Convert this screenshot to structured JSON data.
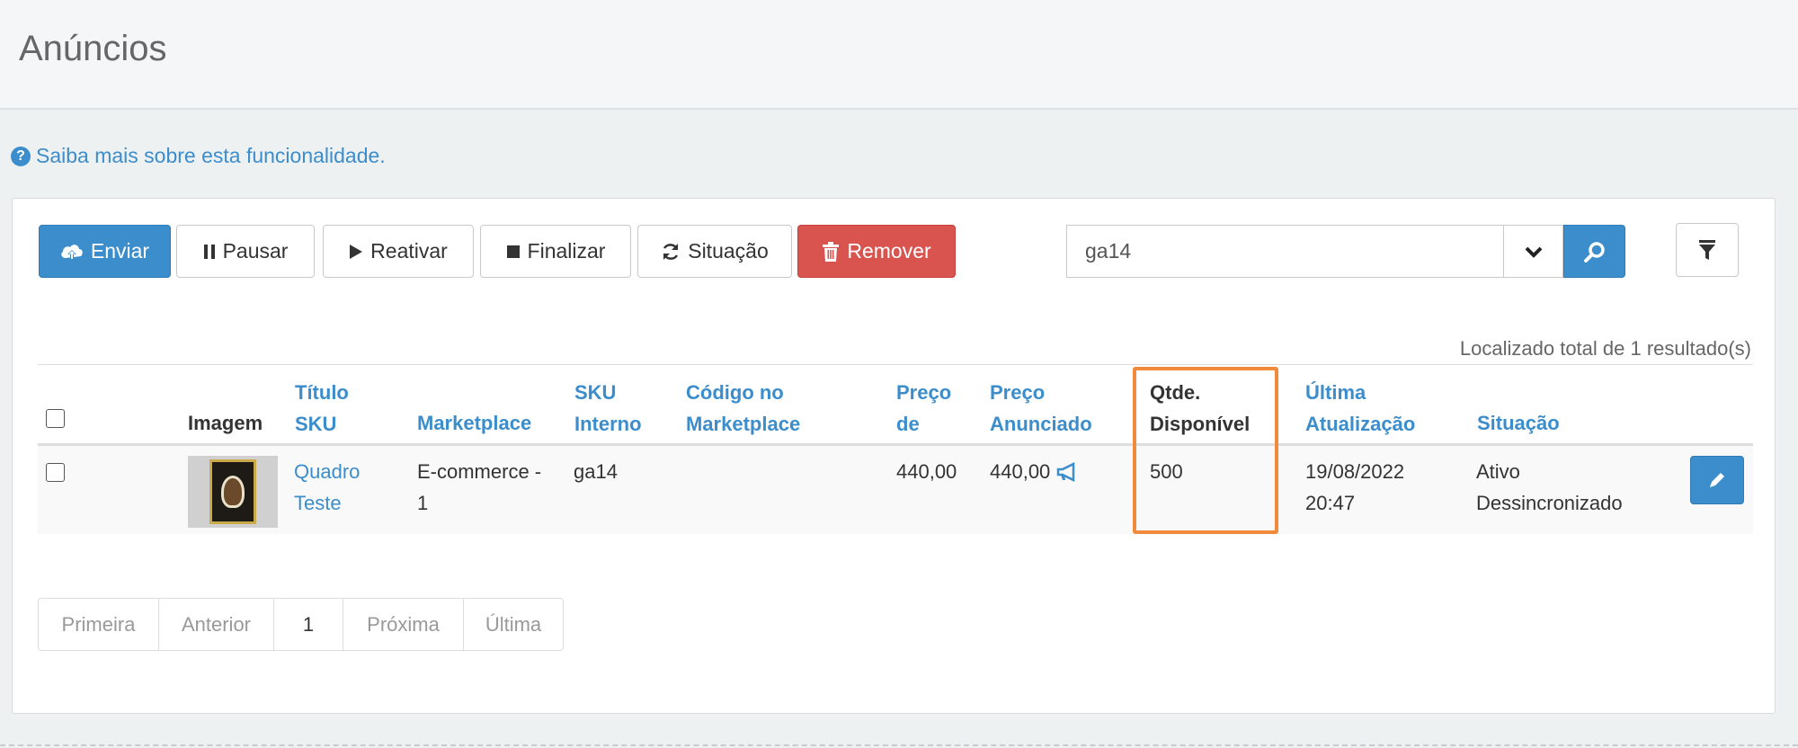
{
  "page": {
    "title": "Anúncios",
    "help_link": "Saiba mais sobre esta funcionalidade."
  },
  "toolbar": {
    "send": "Enviar",
    "pause": "Pausar",
    "reactivate": "Reativar",
    "finish": "Finalizar",
    "status": "Situação",
    "remove": "Remover"
  },
  "search": {
    "value": "ga14"
  },
  "results": {
    "total": "Localizado total de 1 resultado(s)"
  },
  "table": {
    "headers": {
      "image": "Imagem",
      "title_line1": "Título",
      "title_line2": "SKU",
      "marketplace": "Marketplace",
      "sku_line1": "SKU",
      "sku_line2": "Interno",
      "code_line1": "Código no",
      "code_line2": "Marketplace",
      "price_line1": "Preço",
      "price_line2": "de",
      "listed_line1": "Preço",
      "listed_line2": "Anunciado",
      "qty_line1": "Qtde.",
      "qty_line2": "Disponível",
      "updated_line1": "Última",
      "updated_line2": "Atualização",
      "status": "Situação"
    },
    "rows": [
      {
        "title_line1": "Quadro",
        "title_line2": "Teste",
        "marketplace_line1": "E-commerce -",
        "marketplace_line2": "1",
        "sku": "ga14",
        "price": "440,00",
        "listed_price": "440,00",
        "quantity": "500",
        "updated_date": "19/08/2022",
        "updated_time": "20:47",
        "status_line1": "Ativo",
        "status_line2": "Dessincronizado"
      }
    ]
  },
  "pagination": {
    "first": "Primeira",
    "previous": "Anterior",
    "current": "1",
    "next": "Próxima",
    "last": "Última"
  },
  "colors": {
    "primary": "#3c8dcb",
    "danger": "#d9534f",
    "highlight": "#f28a3b"
  }
}
